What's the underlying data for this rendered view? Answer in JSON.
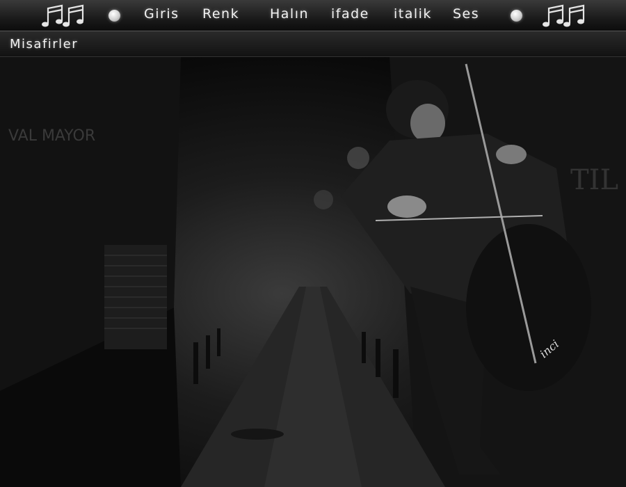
{
  "nav": {
    "items": [
      "Giris",
      "Renk",
      "Halın",
      "ifade",
      "italik",
      "Ses"
    ]
  },
  "subnav": {
    "guests_label": "Misafirler"
  },
  "scene": {
    "signature": "inci",
    "wall_sign_left": "VAL MAYOR",
    "wall_sign_right": "TIL"
  },
  "colors": {
    "bar_top": "#3a3a3a",
    "bar_bottom": "#0c0c0c",
    "text": "#f2f2f2"
  },
  "icons": [
    "music-notes-icon",
    "bullet-dot-icon"
  ]
}
